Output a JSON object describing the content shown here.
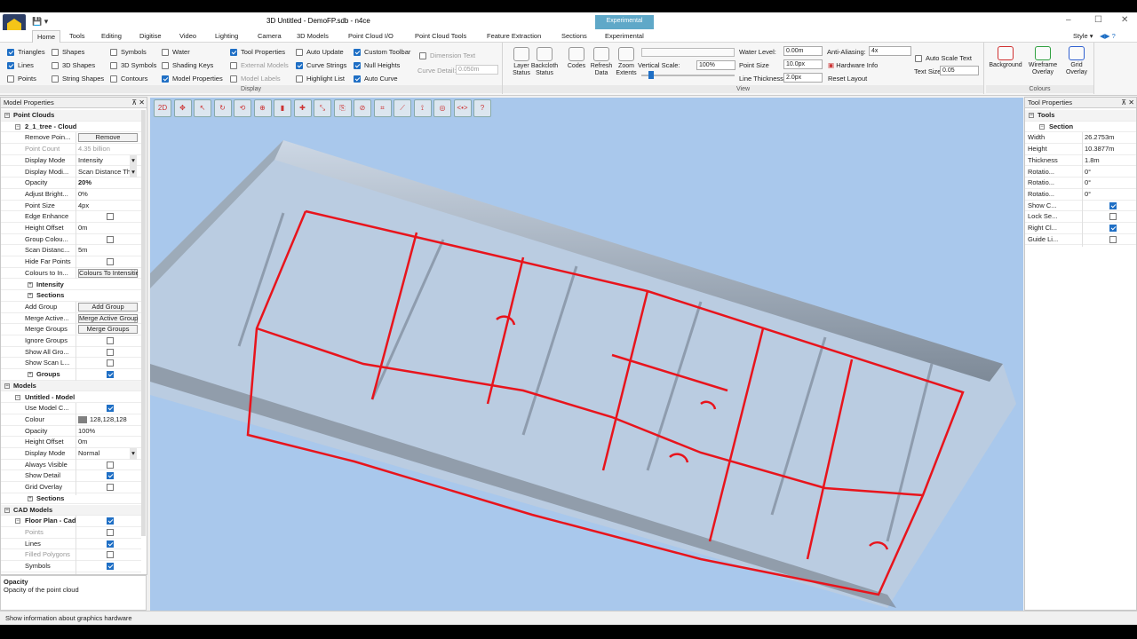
{
  "window": {
    "title": "3D Untitled - DemoFP.sdb - n4ce",
    "context_tab": "Experimental",
    "minimize": "–",
    "maximize": "☐",
    "close": "✕",
    "style_label": "Style"
  },
  "tabs": [
    "Home",
    "Tools",
    "Editing",
    "Digitise",
    "Video",
    "Lighting",
    "Camera",
    "3D Models",
    "Point Cloud I/O",
    "Point Cloud Tools",
    "Feature Extraction",
    "Sections",
    "Experimental"
  ],
  "display_group": {
    "caption": "Display",
    "col1": [
      {
        "label": "Triangles",
        "on": true
      },
      {
        "label": "Lines",
        "on": true
      },
      {
        "label": "Points",
        "on": false
      }
    ],
    "col2": [
      {
        "label": "Shapes",
        "on": false
      },
      {
        "label": "3D Shapes",
        "on": false
      },
      {
        "label": "String Shapes",
        "on": false
      }
    ],
    "col3": [
      {
        "label": "Symbols",
        "on": false
      },
      {
        "label": "3D Symbols",
        "on": false
      },
      {
        "label": "Contours",
        "on": false
      }
    ],
    "col4": [
      {
        "label": "Water",
        "on": false
      },
      {
        "label": "Shading Keys",
        "on": false
      },
      {
        "label": "Model Properties",
        "on": true
      }
    ],
    "col5": [
      {
        "label": "Tool Properties",
        "on": true
      },
      {
        "label": "External Models",
        "on": false,
        "dim": true
      },
      {
        "label": "Model Labels",
        "on": false,
        "dim": true
      }
    ],
    "col6": [
      {
        "label": "Auto Update",
        "on": false
      },
      {
        "label": "Curve Strings",
        "on": true
      },
      {
        "label": "Highlight List",
        "on": false
      }
    ],
    "col7": [
      {
        "label": "Custom Toolbar",
        "on": true
      },
      {
        "label": "Null Heights",
        "on": true
      },
      {
        "label": "Auto Curve",
        "on": true
      }
    ],
    "dimension_text": "Dimension Text",
    "curve_detail_label": "Curve Detail:",
    "curve_detail_value": "0.050m"
  },
  "view_group": {
    "caption": "View",
    "buttons": [
      "Layer\nStatus",
      "Backcloth\nStatus",
      "Codes",
      "Refresh\nData",
      "Zoom\nExtents"
    ],
    "vertical_scale_label": "Vertical Scale:",
    "vertical_scale_value": "100%",
    "water_level_label": "Water Level:",
    "water_level_value": "0.00m",
    "point_size_label": "Point Size",
    "point_size_value": "10.0px",
    "line_thickness_label": "Line Thickness",
    "line_thickness_value": "2.0px",
    "anti_aliasing_label": "Anti-Aliasing:",
    "anti_aliasing_value": "4x",
    "hardware_info": "Hardware Info",
    "reset_layout": "Reset Layout",
    "auto_scale_text": "Auto Scale Text",
    "text_size_label": "Text Size",
    "text_size_value": "0.05"
  },
  "colours_group": {
    "caption": "Colours",
    "buttons": [
      "Background",
      "Wireframe\nOverlay",
      "Grid\nOverlay"
    ]
  },
  "model_properties": {
    "title": "Model Properties",
    "rows": [
      {
        "type": "cat",
        "k": "Point Clouds"
      },
      {
        "type": "sub",
        "k": "2_1_tree - Cloud"
      },
      {
        "k": "Remove Poin...",
        "btn": "Remove"
      },
      {
        "k": "Point Count",
        "v": "4.35 billion",
        "dim": true
      },
      {
        "k": "Display Mode",
        "v": "Intensity",
        "dd": true
      },
      {
        "k": "Display Modi...",
        "v": "Scan Distance Th",
        "dd": true
      },
      {
        "k": "Opacity",
        "v": "20%",
        "bold": true
      },
      {
        "k": "Adjust Bright...",
        "v": "0%"
      },
      {
        "k": "Point Size",
        "v": "4px"
      },
      {
        "k": "Edge Enhance",
        "check": false
      },
      {
        "k": "Height Offset",
        "v": "0m"
      },
      {
        "k": "Group Colou...",
        "check": false
      },
      {
        "k": "Scan Distanc...",
        "v": "5m"
      },
      {
        "k": "Hide Far Points",
        "check": false
      },
      {
        "k": "Colours to In...",
        "btn": "Colours To Intensitie"
      },
      {
        "type": "sub2",
        "k": "Intensity"
      },
      {
        "type": "sub2",
        "k": "Sections"
      },
      {
        "k": "Add Group",
        "btn": "Add Group"
      },
      {
        "k": "Merge Active...",
        "btn": "Merge Active Group"
      },
      {
        "k": "Merge Groups",
        "btn": "Merge Groups"
      },
      {
        "k": "Ignore Groups",
        "check": false
      },
      {
        "k": "Show All Gro...",
        "check": false
      },
      {
        "k": "Show Scan L...",
        "check": false
      },
      {
        "type": "sub2",
        "k": "Groups",
        "check": true
      },
      {
        "type": "cat",
        "k": "Models"
      },
      {
        "type": "sub",
        "k": "Untitled - Model"
      },
      {
        "k": "Use Model C...",
        "check": true
      },
      {
        "k": "Colour",
        "v": "128,128,128",
        "swatch": "#808080"
      },
      {
        "k": "Opacity",
        "v": "100%"
      },
      {
        "k": "Height Offset",
        "v": "0m"
      },
      {
        "k": "Display Mode",
        "v": "Normal",
        "dd": true
      },
      {
        "k": "Always Visible",
        "check": false
      },
      {
        "k": "Show Detail",
        "check": true
      },
      {
        "k": "Grid Overlay",
        "check": false
      },
      {
        "type": "sub2",
        "k": "Sections"
      },
      {
        "type": "cat",
        "k": "CAD Models"
      },
      {
        "type": "sub",
        "k": "Floor Plan - Cad",
        "check": true
      },
      {
        "k": "Points",
        "check": false,
        "dim": true
      },
      {
        "k": "Lines",
        "check": true
      },
      {
        "k": "Filled Polygons",
        "check": false,
        "dim": true
      },
      {
        "k": "Symbols",
        "check": true
      }
    ],
    "desc_title": "Opacity",
    "desc_text": "Opacity of the point cloud"
  },
  "tool_properties": {
    "title": "Tool Properties",
    "rows": [
      {
        "type": "cat",
        "k": "Tools"
      },
      {
        "type": "sub",
        "k": "Section"
      },
      {
        "k": "Width",
        "v": "26.2753m"
      },
      {
        "k": "Height",
        "v": "10.3877m"
      },
      {
        "k": "Thickness",
        "v": "1.8m"
      },
      {
        "k": "Rotatio...",
        "v": "0°"
      },
      {
        "k": "Rotatio...",
        "v": "0°"
      },
      {
        "k": "Rotatio...",
        "v": "0°"
      },
      {
        "k": "Show C...",
        "check": true
      },
      {
        "k": "Lock Se...",
        "check": false
      },
      {
        "k": "Right Cl...",
        "check": true
      },
      {
        "k": "Guide Li...",
        "check": false
      }
    ]
  },
  "status_bar": "Show information about graphics hardware",
  "viewport_tools": [
    "2D",
    "✥",
    "↖",
    "↻",
    "⟲",
    "⊕",
    "▮",
    "✚",
    "⤡",
    "⎘",
    "⊘",
    "⌗",
    "⟋",
    "⟟",
    "◎",
    "<•>",
    "?"
  ],
  "accent": "#1f6fc5",
  "floorplan_color": "#e8141c"
}
